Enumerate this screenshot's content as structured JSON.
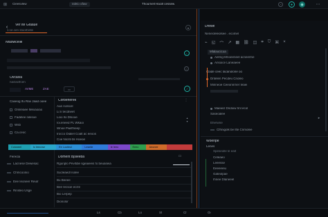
{
  "titlebar": {
    "title": "Thournell Hacill cessew",
    "tab_label": "Cleesvlew",
    "chip_label": "Ialeio ofaw"
  },
  "toolbar": {
    "title": "Ver Ite Gfaaue",
    "subtitle": "1:ce.cen stoolCelle"
  },
  "left_panel": {
    "header": "Nfaowcelle",
    "search_label": "Ovcalva",
    "search_sub": "naclactfcen",
    "tags": [
      "AVME",
      "ZAE"
    ],
    "list_header": "Caxeog Ifu Rav Jaad ooee",
    "list_items": [
      "Onlireaee Mexaoiao",
      "Fadelee nilesoe",
      "Wsb",
      "Ca.ceoc"
    ],
    "lower_header": "Ferecla",
    "lower_items": [
      "Lacnese Dewesac",
      "Chmcoonio",
      "Eee Ieoneer Reulr",
      "Rinsleo Usge"
    ]
  },
  "center_panel": {
    "header": "Corbenerek",
    "items": [
      "Aue Aolscel",
      "Li:n tecdneet",
      "Loio Ilo Dlsooe",
      "Ioi.eneed PL Wkaoi",
      "Wnoe Pwiiffneep",
      "Irocco Dialiel Coalt ac eeoos",
      "Coe Nicriti bli Hoeoe"
    ],
    "lower_header": "Domerit Bjsleeba",
    "lower_items": [
      "Rgunplo Pevifdie sgeaieeis fo beuaseia",
      "Sucleaedl nolee",
      "Bu Beeee",
      "Bee Iecsoe ecrre",
      "Bio Lerpep",
      "Dionolor"
    ]
  },
  "timeline": {
    "segments": [
      {
        "label": "Coloneel",
        "color": "#1f9fb0"
      },
      {
        "label": "Ic Ieecvse",
        "color": "#2aa5c9"
      },
      {
        "label": "Ee Loolieol",
        "color": "#2c8fd6"
      },
      {
        "label": "Leseiie",
        "color": "#2f7bd9"
      },
      {
        "label": "Ie Ieeo",
        "color": "#7c48c9"
      },
      {
        "label": "Eeeo",
        "color": "#2f9e4e"
      },
      {
        "label": "Aeonee",
        "color": "#cf6b2a"
      },
      {
        "label": "",
        "color": "#c23b3b"
      }
    ]
  },
  "right_panel": {
    "header": "Drewe",
    "subheader": "Nenecleleolsee . ecomel",
    "section1_header": "Mlalaocicoa",
    "section1_items": [
      "Aelmg-Mnoeeneel acneerlne",
      "Ansoice Laneaeee"
    ],
    "section2_header": "Clade ceec Iacanolone oo",
    "section2_items": [
      "Dntelen Pecdeu Cnoleo",
      "Minneoe Ceeonnrner Ieaei"
    ],
    "section3_items": [
      "Maewcl Dndoiw hnl ecol",
      "Saseoalee"
    ],
    "section4_header": "Eherwne",
    "section4_item": "Cfhnigolk be Ilte Cnmolee",
    "section5_header": "Woenpe",
    "section5_sub": "Lenes",
    "section5_sub2": "Speseolle le ealt",
    "section5_items": [
      "Celeaeo",
      "Leeesse",
      "Eeeeeeiu",
      "Gateolpae",
      "Ihnee Dlaneeel"
    ]
  },
  "statusbar": {
    "items": [
      "Ls",
      "Cb",
      "Lo",
      "Sf",
      "Cf",
      "Oi"
    ]
  },
  "colors": {
    "accent_orange": "#e0682a",
    "accent_blue": "#2f7bd9",
    "accent_green": "#2f9e4e",
    "teal": "#1fb3a6"
  }
}
